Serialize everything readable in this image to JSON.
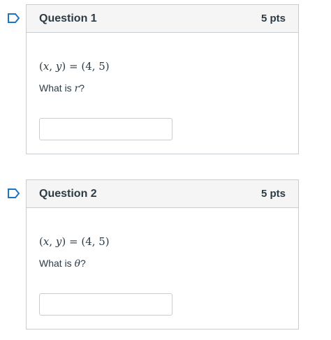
{
  "questions": [
    {
      "title": "Question 1",
      "points": "5 pts",
      "math": {
        "lhs_x": "x",
        "sep": ",",
        "lhs_y": "y",
        "rhs": "= (4, 5)"
      },
      "prompt": {
        "before": "What is ",
        "variable": "r",
        "after": "?"
      },
      "answer_value": "",
      "flag_icon": "flag-outline-icon"
    },
    {
      "title": "Question 2",
      "points": "5 pts",
      "math": {
        "lhs_x": "x",
        "sep": ",",
        "lhs_y": "y",
        "rhs": "= (4, 5)"
      },
      "prompt": {
        "before": "What is ",
        "variable": "θ",
        "after": "?"
      },
      "answer_value": "",
      "flag_icon": "flag-outline-icon"
    }
  ],
  "colors": {
    "flag": "#1d73c4",
    "border": "#c7cdd1",
    "header_bg": "#f5f5f5",
    "text": "#2d3b45"
  }
}
